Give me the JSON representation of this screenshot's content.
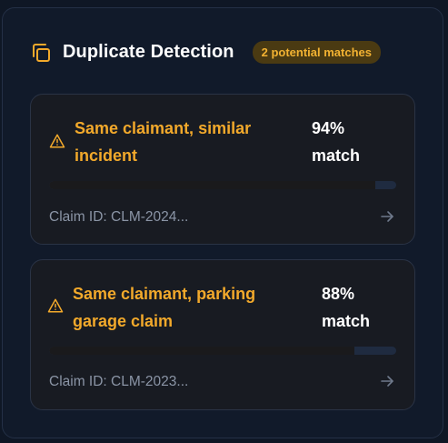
{
  "header": {
    "title": "Duplicate Detection",
    "badge": "2 potential matches",
    "accent": "#f2a92b"
  },
  "matches": [
    {
      "title_line1": "Same claimant, similar",
      "title_line2": "incident",
      "percent_line1": "94%",
      "percent_line2": "match",
      "match_fraction": 0.94,
      "claim_id": "Claim ID: CLM-2024...",
      "icon": "warning-icon"
    },
    {
      "title_line1": "Same claimant, parking",
      "title_line2": "garage claim",
      "percent_line1": "88%",
      "percent_line2": "match",
      "match_fraction": 0.88,
      "claim_id": "Claim ID: CLM-2023...",
      "icon": "warning-icon"
    }
  ]
}
